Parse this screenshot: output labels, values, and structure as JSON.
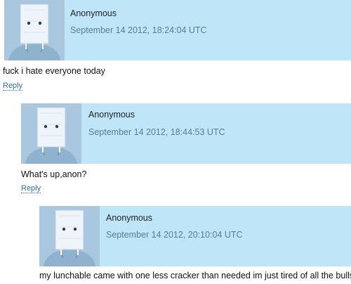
{
  "comments": [
    {
      "author": "Anonymous",
      "timestamp": "September 14 2012, 18:24:04 UTC",
      "body": "fuck i hate everyone today",
      "reply_label": "Reply"
    },
    {
      "author": "Anonymous",
      "timestamp": "September 14 2012, 18:44:53 UTC",
      "body": "What's up,anon?",
      "reply_label": "Reply"
    },
    {
      "author": "Anonymous",
      "timestamp": "September 14 2012, 20:10:04 UTC",
      "body": "my lunchable came with one less cracker than needed im just tired of all the bullshit"
    }
  ],
  "colors": {
    "header_band": "#bfe6f8",
    "timestamp": "#5a7c92",
    "link": "#2f6ea8"
  },
  "icons": {
    "avatar": "paper-bag-head-avatar-icon"
  }
}
